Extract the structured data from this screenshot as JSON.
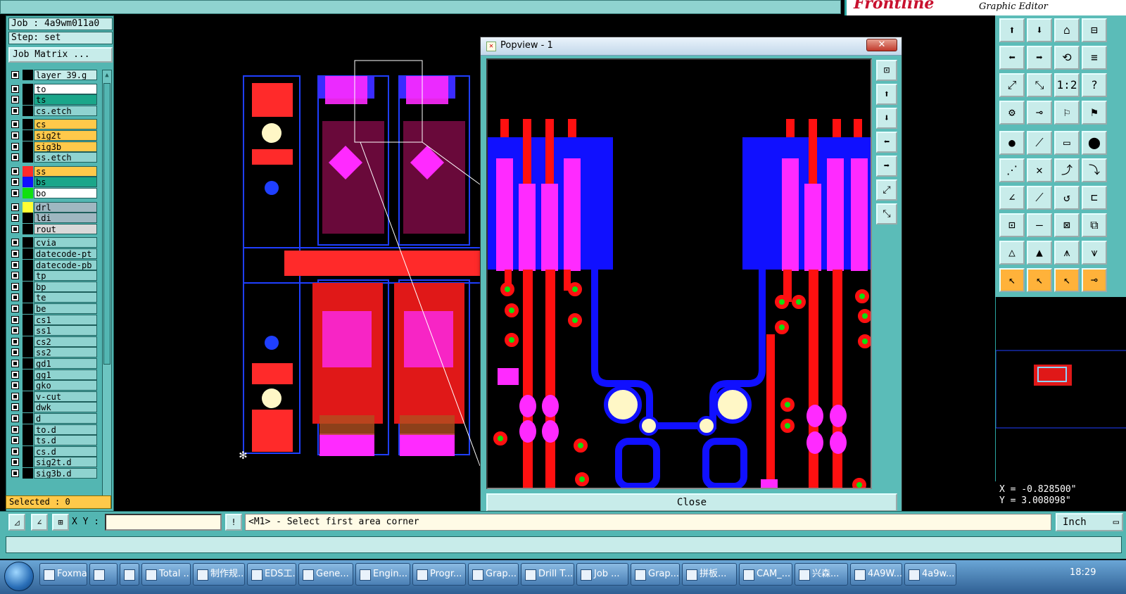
{
  "brand": {
    "subtitle": "Graphic Editor"
  },
  "job": {
    "job_label": "Job : 4a9wm011a0",
    "step_label": "Step: set",
    "matrix_button": "Job Matrix ..."
  },
  "layers": [
    {
      "name": "layer_39.g",
      "color": "#ffffff",
      "bg": "#c7ecea"
    },
    {
      "name": "to",
      "color": "#ffffff",
      "bg": "#ffffff"
    },
    {
      "name": "ts",
      "color": "#ffffff",
      "bg": "#1aa68a"
    },
    {
      "name": "cs.etch",
      "color": "#ffffff",
      "bg": "#8fd3d0"
    },
    {
      "name": "cs",
      "color": "#ffffff",
      "bg": "#ffc94a"
    },
    {
      "name": "sig2t",
      "color": "#ffffff",
      "bg": "#ffc94a"
    },
    {
      "name": "sig3b",
      "color": "#ffffff",
      "bg": "#ffc94a"
    },
    {
      "name": "ss.etch",
      "color": "#ffffff",
      "bg": "#8fd3d0"
    },
    {
      "name": "ss",
      "color": "#ff2a2a",
      "bg": "#ffc94a"
    },
    {
      "name": "bs",
      "color": "#1010ff",
      "bg": "#1aa68a"
    },
    {
      "name": "bo",
      "color": "#10e010",
      "bg": "#ffffff"
    },
    {
      "name": "drl",
      "color": "#ffff33",
      "bg": "#9fb7c1"
    },
    {
      "name": "ldi",
      "color": "#ffffff",
      "bg": "#9fb7c1"
    },
    {
      "name": "rout",
      "color": "#ffffff",
      "bg": "#d9d9d9"
    },
    {
      "name": "cvia",
      "color": "#ffffff",
      "bg": "#8fd3d0"
    },
    {
      "name": "datecode-pt",
      "color": "#ffffff",
      "bg": "#8fd3d0"
    },
    {
      "name": "datecode-pb",
      "color": "#ffffff",
      "bg": "#8fd3d0"
    },
    {
      "name": "tp",
      "color": "#ffffff",
      "bg": "#8fd3d0"
    },
    {
      "name": "bp",
      "color": "#ffffff",
      "bg": "#8fd3d0"
    },
    {
      "name": "te",
      "color": "#ffffff",
      "bg": "#8fd3d0"
    },
    {
      "name": "be",
      "color": "#ffffff",
      "bg": "#8fd3d0"
    },
    {
      "name": "cs1",
      "color": "#ffffff",
      "bg": "#8fd3d0"
    },
    {
      "name": "ss1",
      "color": "#ffffff",
      "bg": "#8fd3d0"
    },
    {
      "name": "cs2",
      "color": "#ffffff",
      "bg": "#8fd3d0"
    },
    {
      "name": "ss2",
      "color": "#ffffff",
      "bg": "#8fd3d0"
    },
    {
      "name": "gd1",
      "color": "#ffffff",
      "bg": "#8fd3d0"
    },
    {
      "name": "gg1",
      "color": "#ffffff",
      "bg": "#8fd3d0"
    },
    {
      "name": "gko",
      "color": "#ffffff",
      "bg": "#8fd3d0"
    },
    {
      "name": "v-cut",
      "color": "#ffffff",
      "bg": "#8fd3d0"
    },
    {
      "name": "dwk",
      "color": "#ffffff",
      "bg": "#8fd3d0"
    },
    {
      "name": "d",
      "color": "#ffffff",
      "bg": "#8fd3d0"
    },
    {
      "name": "to.d",
      "color": "#ffffff",
      "bg": "#8fd3d0"
    },
    {
      "name": "ts.d",
      "color": "#ffffff",
      "bg": "#8fd3d0"
    },
    {
      "name": "cs.d",
      "color": "#ffffff",
      "bg": "#8fd3d0"
    },
    {
      "name": "sig2t.d",
      "color": "#ffffff",
      "bg": "#8fd3d0"
    },
    {
      "name": "sig3b.d",
      "color": "#ffffff",
      "bg": "#8fd3d0"
    }
  ],
  "selected": "Selected : 0",
  "cmd": {
    "xy_label": "X Y :",
    "xy_value": "",
    "prompt": "<M1> - Select first area corner",
    "unit": "Inch"
  },
  "coords": {
    "x": "X = -0.828500\"",
    "y": "Y = 3.008098\""
  },
  "popview": {
    "title": "Popview - 1",
    "close_label": "Close"
  },
  "taskbar": {
    "items": [
      "Foxmail",
      "",
      "",
      "Total ...",
      "制作规...",
      "EDS工...",
      "Gene...",
      "Engin...",
      "Progr...",
      "Grap...",
      "Drill T...",
      "Job ...",
      "Grap...",
      "拼板...",
      "CAM_...",
      "兴森...",
      "4A9W...",
      "4a9w..."
    ],
    "clock": "18:29"
  }
}
